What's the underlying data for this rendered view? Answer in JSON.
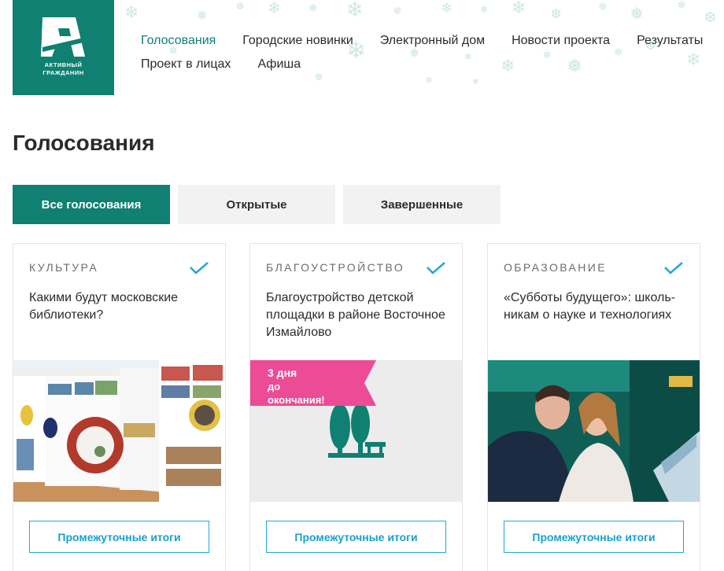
{
  "logo": {
    "line1": "АКТИВНЫЙ",
    "line2": "ГРАЖДАНИН"
  },
  "nav": {
    "row1": [
      "Голосования",
      "Городские новинки",
      "Электронный дом",
      "Новости проекта",
      "Результаты"
    ],
    "row2": [
      "Проект в лицах",
      "Афиша"
    ]
  },
  "page_title": "Голосования",
  "tabs": [
    "Все голосования",
    "Открытые",
    "Завершенные"
  ],
  "cards": [
    {
      "category": "КУЛЬТУРА",
      "title": "Какими будут московские библиотеки?",
      "button": "Промежуточные итоги"
    },
    {
      "category": "БЛАГОУСТРОЙСТВО",
      "title": "Благоустройство детской площадки в районе Восточное Измайлово",
      "badge_days": "3 дня",
      "badge_suffix": "до окончания!",
      "button": "Промежуточные итоги"
    },
    {
      "category": "ОБРАЗОВАНИЕ",
      "title": "«Субботы будущего»: школь-никам о науке и технологиях",
      "button": "Промежуточные итоги"
    }
  ],
  "colors": {
    "brand": "#0f8071",
    "accent_blue": "#22a7d5",
    "badge_pink": "#ec4b95"
  },
  "icons": [
    "snowflake-icon",
    "checkmark-icon",
    "park-trees-icon"
  ]
}
